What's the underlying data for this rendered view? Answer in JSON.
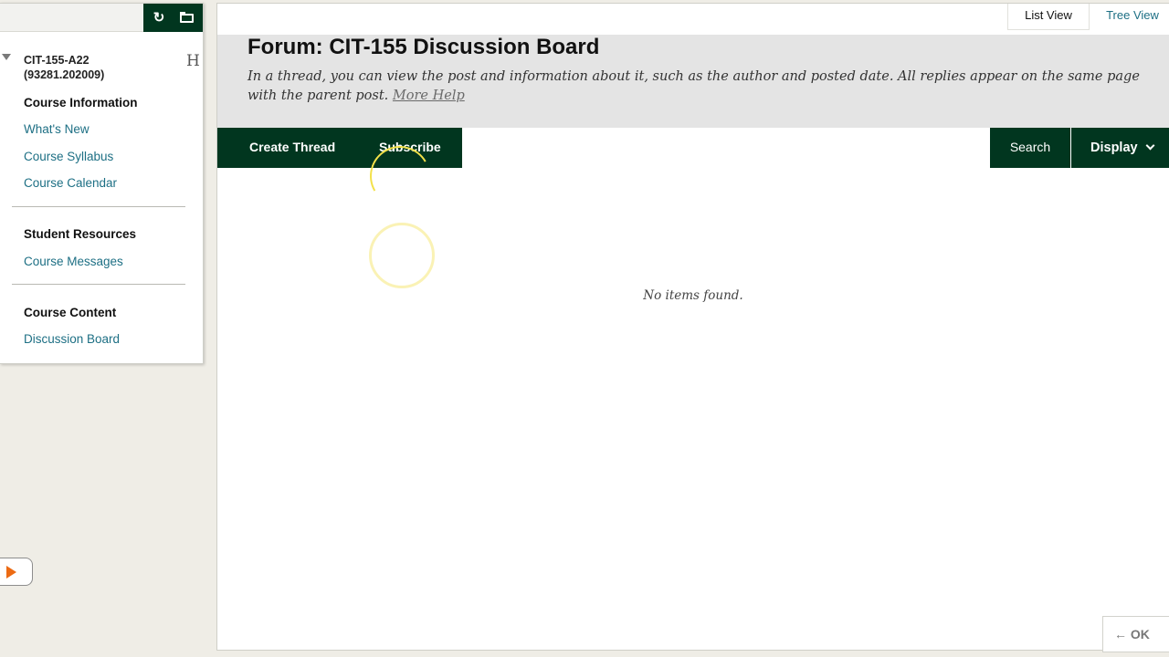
{
  "course_menu": {
    "course_id": "CIT-155-A22",
    "course_code": "(93281.202009)",
    "home_glyph": "H",
    "sections": [
      {
        "heading": "Course Information",
        "items": [
          "What's New",
          "Course Syllabus",
          "Course Calendar"
        ]
      },
      {
        "heading": "Student Resources",
        "items": [
          "Course Messages"
        ]
      },
      {
        "heading": "Course Content",
        "items": [
          "Discussion Board"
        ]
      }
    ],
    "icons": [
      "refresh-icon",
      "folder-icon",
      "chevron-down-icon",
      "home-icon",
      "play-icon"
    ]
  },
  "view_switcher": {
    "list_view": "List View",
    "tree_view": "Tree View"
  },
  "header": {
    "title": "Forum: CIT-155 Discussion Board",
    "instructions": "In a thread, you can view the post and information about it, such as the author and posted date. All replies appear on the same page with the parent post.",
    "more_help": "More Help"
  },
  "action_bar": {
    "create_thread": "Create Thread",
    "subscribe": "Subscribe",
    "search": "Search",
    "display": "Display"
  },
  "content": {
    "empty_message": "No items found."
  },
  "footer": {
    "ok_label": "OK",
    "ok_arrow": "←"
  },
  "colors": {
    "brand_dark_green": "#01361f",
    "link_teal": "#1d6f84",
    "header_gray": "#e4e4e4",
    "play_orange": "#ec6a13",
    "click_highlight": "#f3e14a"
  }
}
